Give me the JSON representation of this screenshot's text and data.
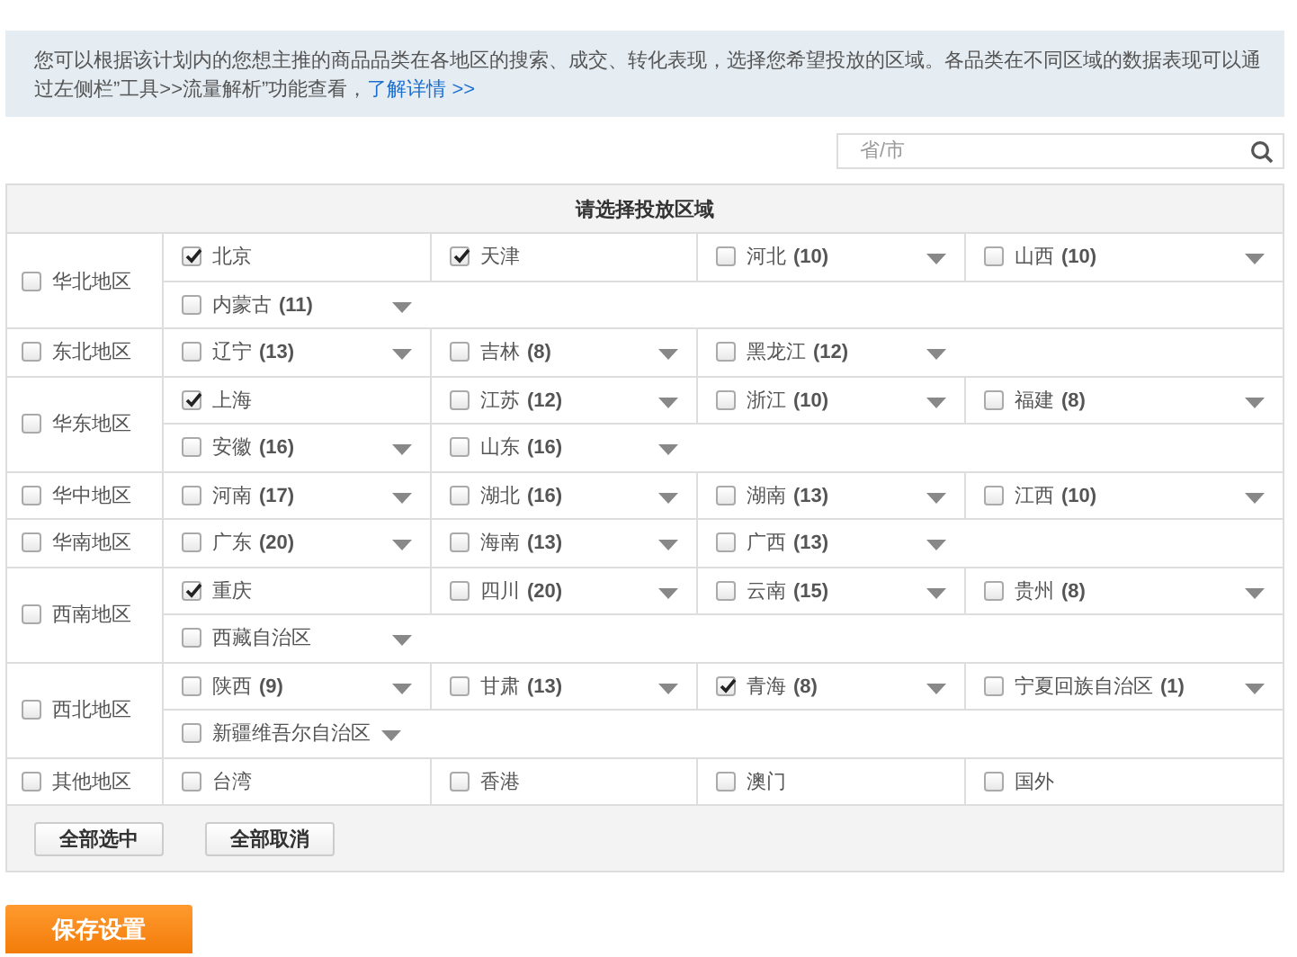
{
  "notice": {
    "text": "您可以根据该计划内的您想主推的商品品类在各地区的搜索、成交、转化表现，选择您希望投放的区域。各品类在不同区域的数据表现可以通过左侧栏”工具>>流量解析”功能查看，",
    "link": "了解详情 >>"
  },
  "search": {
    "placeholder": "省/市"
  },
  "table": {
    "title": "请选择投放区域",
    "regions": [
      {
        "name": "华北地区",
        "checked": false,
        "provinces": [
          {
            "name": "北京",
            "checked": true,
            "dropdown": false
          },
          {
            "name": "天津",
            "checked": true,
            "dropdown": false
          },
          {
            "name": "河北",
            "count": "(10)",
            "checked": false,
            "dropdown": true
          },
          {
            "name": "山西",
            "count": "(10)",
            "checked": false,
            "dropdown": true
          },
          {
            "name": "内蒙古",
            "count": "(11)",
            "checked": false,
            "dropdown": true
          }
        ]
      },
      {
        "name": "东北地区",
        "checked": false,
        "provinces": [
          {
            "name": "辽宁",
            "count": "(13)",
            "checked": false,
            "dropdown": true
          },
          {
            "name": "吉林",
            "count": "(8)",
            "checked": false,
            "dropdown": true
          },
          {
            "name": "黑龙江",
            "count": "(12)",
            "checked": false,
            "dropdown": true
          }
        ]
      },
      {
        "name": "华东地区",
        "checked": false,
        "provinces": [
          {
            "name": "上海",
            "checked": true,
            "dropdown": false
          },
          {
            "name": "江苏",
            "count": "(12)",
            "checked": false,
            "dropdown": true
          },
          {
            "name": "浙江",
            "count": "(10)",
            "checked": false,
            "dropdown": true
          },
          {
            "name": "福建",
            "count": "(8)",
            "checked": false,
            "dropdown": true
          },
          {
            "name": "安徽",
            "count": "(16)",
            "checked": false,
            "dropdown": true
          },
          {
            "name": "山东",
            "count": "(16)",
            "checked": false,
            "dropdown": true
          }
        ]
      },
      {
        "name": "华中地区",
        "checked": false,
        "provinces": [
          {
            "name": "河南",
            "count": "(17)",
            "checked": false,
            "dropdown": true
          },
          {
            "name": "湖北",
            "count": "(16)",
            "checked": false,
            "dropdown": true
          },
          {
            "name": "湖南",
            "count": "(13)",
            "checked": false,
            "dropdown": true
          },
          {
            "name": "江西",
            "count": "(10)",
            "checked": false,
            "dropdown": true
          }
        ]
      },
      {
        "name": "华南地区",
        "checked": false,
        "provinces": [
          {
            "name": "广东",
            "count": "(20)",
            "checked": false,
            "dropdown": true
          },
          {
            "name": "海南",
            "count": "(13)",
            "checked": false,
            "dropdown": true
          },
          {
            "name": "广西",
            "count": "(13)",
            "checked": false,
            "dropdown": true
          }
        ]
      },
      {
        "name": "西南地区",
        "checked": false,
        "provinces": [
          {
            "name": "重庆",
            "checked": true,
            "dropdown": false
          },
          {
            "name": "四川",
            "count": "(20)",
            "checked": false,
            "dropdown": true
          },
          {
            "name": "云南",
            "count": "(15)",
            "checked": false,
            "dropdown": true
          },
          {
            "name": "贵州",
            "count": "(8)",
            "checked": false,
            "dropdown": true
          },
          {
            "name": "西藏自治区",
            "checked": false,
            "dropdown": true
          }
        ]
      },
      {
        "name": "西北地区",
        "checked": false,
        "provinces": [
          {
            "name": "陕西",
            "count": "(9)",
            "checked": false,
            "dropdown": true
          },
          {
            "name": "甘肃",
            "count": "(13)",
            "checked": false,
            "dropdown": true
          },
          {
            "name": "青海",
            "count": "(8)",
            "checked": true,
            "dropdown": true
          },
          {
            "name": "宁夏回族自治区",
            "count": "(1)",
            "checked": false,
            "dropdown": true
          },
          {
            "name": "新疆维吾尔自治区",
            "checked": false,
            "dropdown": true
          }
        ]
      },
      {
        "name": "其他地区",
        "checked": false,
        "provinces": [
          {
            "name": "台湾",
            "checked": false,
            "dropdown": false
          },
          {
            "name": "香港",
            "checked": false,
            "dropdown": false
          },
          {
            "name": "澳门",
            "checked": false,
            "dropdown": false
          },
          {
            "name": "国外",
            "checked": false,
            "dropdown": false
          }
        ]
      }
    ],
    "buttons": [
      "全部选中",
      "全部取消"
    ]
  },
  "save_button": "保存设置"
}
